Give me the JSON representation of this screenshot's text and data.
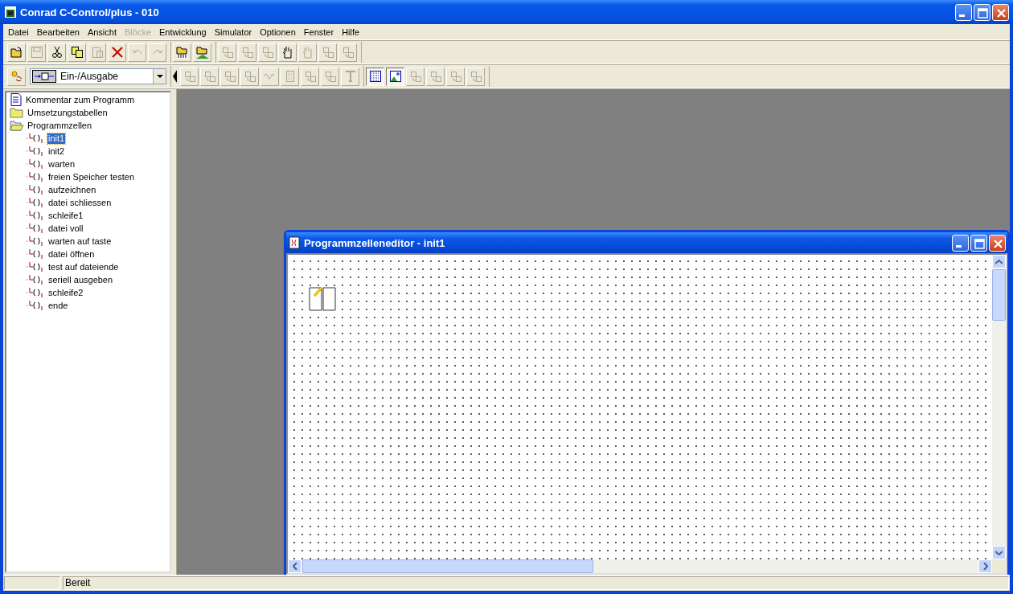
{
  "window": {
    "title": "Conrad C-Control/plus - 010"
  },
  "menu": [
    {
      "label": "Datei",
      "disabled": false
    },
    {
      "label": "Bearbeiten",
      "disabled": false
    },
    {
      "label": "Ansicht",
      "disabled": false
    },
    {
      "label": "Blöcke",
      "disabled": true
    },
    {
      "label": "Entwicklung",
      "disabled": false
    },
    {
      "label": "Simulator",
      "disabled": false
    },
    {
      "label": "Optionen",
      "disabled": false
    },
    {
      "label": "Fenster",
      "disabled": false
    },
    {
      "label": "Hilfe",
      "disabled": false
    }
  ],
  "toolbar1": [
    [
      {
        "disabled": false
      },
      {
        "disabled": true
      },
      {
        "disabled": false
      },
      {
        "disabled": false
      },
      {
        "disabled": true
      },
      {
        "disabled": false
      },
      {
        "disabled": true
      },
      {
        "disabled": true
      }
    ],
    [
      {
        "disabled": false
      },
      {
        "disabled": false
      }
    ],
    [
      {
        "disabled": true
      },
      {
        "disabled": true
      },
      {
        "disabled": true
      },
      {
        "disabled": false
      },
      {
        "disabled": true
      },
      {
        "disabled": true
      },
      {
        "disabled": true
      }
    ]
  ],
  "toolbar2": {
    "block_type": {
      "value": "Ein-/Ausgabe"
    },
    "groups": [
      [
        {
          "disabled": true,
          "pressed": false
        },
        {
          "disabled": true,
          "pressed": false
        },
        {
          "disabled": true,
          "pressed": false
        },
        {
          "disabled": true,
          "pressed": false
        },
        {
          "disabled": true,
          "pressed": false
        },
        {
          "disabled": true,
          "pressed": false
        },
        {
          "disabled": true,
          "pressed": false
        },
        {
          "disabled": true,
          "pressed": false
        },
        {
          "disabled": true,
          "pressed": false
        }
      ],
      [
        {
          "disabled": false,
          "pressed": true
        },
        {
          "disabled": false,
          "pressed": true
        },
        {
          "disabled": true,
          "pressed": false
        },
        {
          "disabled": true,
          "pressed": false
        },
        {
          "disabled": true,
          "pressed": false
        },
        {
          "disabled": true,
          "pressed": false
        }
      ]
    ]
  },
  "tree": [
    {
      "label": "Kommentar zum Programm",
      "kind": "document",
      "selected": false
    },
    {
      "label": "Umsetzungstabellen",
      "kind": "folder",
      "selected": false
    },
    {
      "label": "Programmzellen",
      "kind": "folder",
      "selected": false,
      "expanded": true,
      "children": [
        {
          "label": "init1",
          "kind": "cell",
          "selected": true
        },
        {
          "label": "init2",
          "kind": "cell",
          "selected": false
        },
        {
          "label": "warten",
          "kind": "cell",
          "selected": false
        },
        {
          "label": "freien Speicher testen",
          "kind": "cell",
          "selected": false
        },
        {
          "label": "aufzeichnen",
          "kind": "cell",
          "selected": false
        },
        {
          "label": "datei schliessen",
          "kind": "cell",
          "selected": false
        },
        {
          "label": "schleife1",
          "kind": "cell",
          "selected": false
        },
        {
          "label": "datei voll",
          "kind": "cell",
          "selected": false
        },
        {
          "label": "warten auf taste",
          "kind": "cell",
          "selected": false
        },
        {
          "label": "datei öffnen",
          "kind": "cell",
          "selected": false
        },
        {
          "label": "test auf dateiende",
          "kind": "cell",
          "selected": false
        },
        {
          "label": "seriell ausgeben",
          "kind": "cell",
          "selected": false
        },
        {
          "label": "schleife2",
          "kind": "cell",
          "selected": false
        },
        {
          "label": "ende",
          "kind": "cell",
          "selected": false
        }
      ]
    }
  ],
  "editor": {
    "title": "Programmzelleneditor - init1"
  },
  "status_bar": {
    "text": "Bereit"
  }
}
